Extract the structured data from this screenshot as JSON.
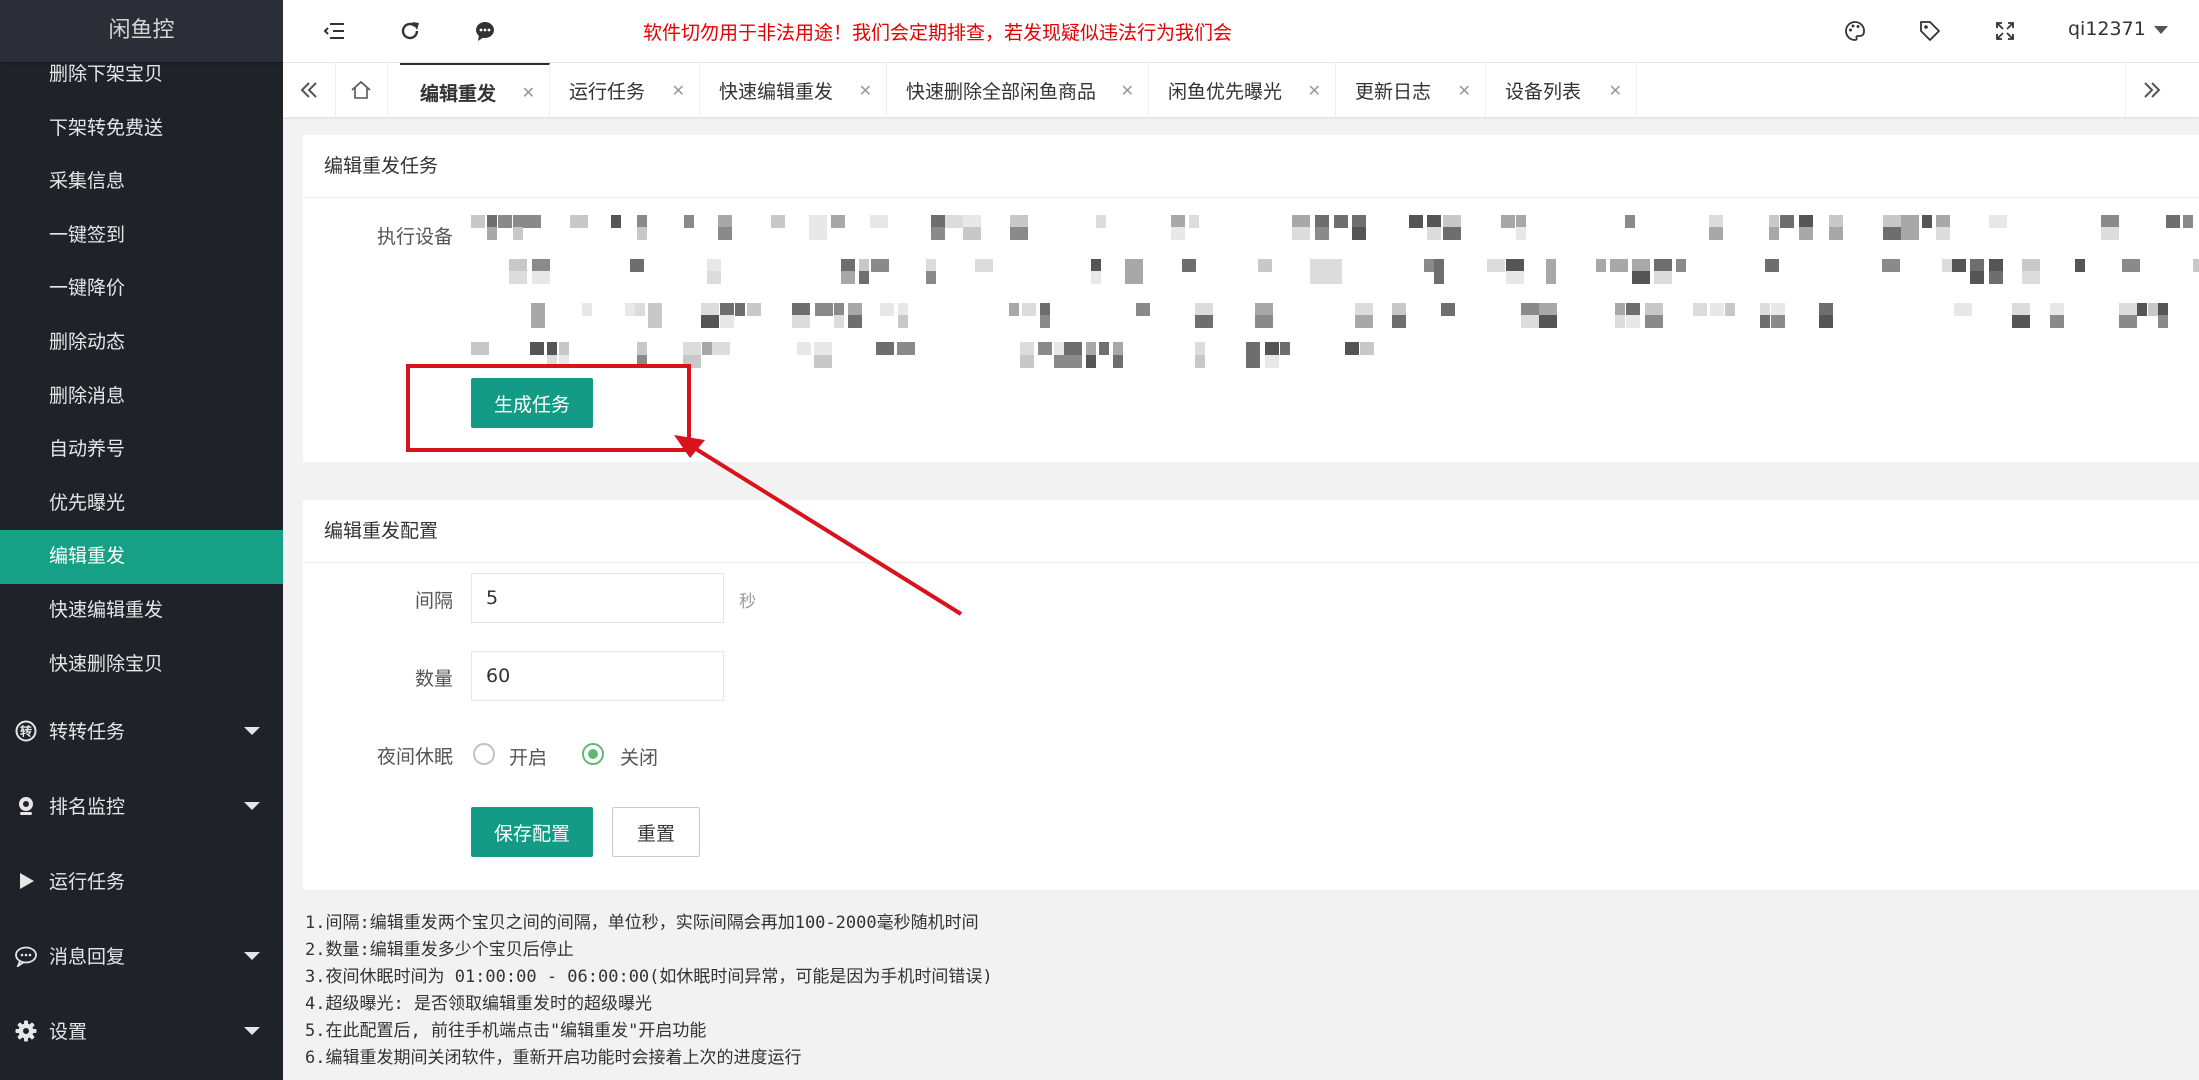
{
  "app": {
    "title": "闲鱼控"
  },
  "sidebar": {
    "sub_items": [
      {
        "label": "删除下架宝贝",
        "active": false
      },
      {
        "label": "下架转免费送",
        "active": false
      },
      {
        "label": "采集信息",
        "active": false
      },
      {
        "label": "一键签到",
        "active": false
      },
      {
        "label": "一键降价",
        "active": false
      },
      {
        "label": "删除动态",
        "active": false
      },
      {
        "label": "删除消息",
        "active": false
      },
      {
        "label": "自动养号",
        "active": false
      },
      {
        "label": "优先曝光",
        "active": false
      },
      {
        "label": "编辑重发",
        "active": true
      },
      {
        "label": "快速编辑重发",
        "active": false
      },
      {
        "label": "快速删除宝贝",
        "active": false
      }
    ],
    "groups": [
      {
        "label": "转转任务",
        "icon": "zhuanzhuan-icon",
        "has_caret": true
      },
      {
        "label": "排名监控",
        "icon": "webcam-icon",
        "has_caret": true
      },
      {
        "label": "运行任务",
        "icon": "play-icon",
        "has_caret": false
      },
      {
        "label": "消息回复",
        "icon": "chat-bubble-icon",
        "has_caret": true
      },
      {
        "label": "设置",
        "icon": "gear-icon",
        "has_caret": true
      }
    ]
  },
  "header": {
    "notice": "软件切勿用于非法用途！我们会定期排查，若发现疑似违法行为我们会",
    "user": "qi12371"
  },
  "tabs": [
    {
      "label": "编辑重发",
      "active": true
    },
    {
      "label": "运行任务",
      "active": false
    },
    {
      "label": "快速编辑重发",
      "active": false
    },
    {
      "label": "快速删除全部闲鱼商品",
      "active": false
    },
    {
      "label": "闲鱼优先曝光",
      "active": false
    },
    {
      "label": "更新日志",
      "active": false
    },
    {
      "label": "设备列表",
      "active": false
    }
  ],
  "task_card": {
    "title": "编辑重发任务",
    "device_label": "执行设备",
    "generate_button": "生成任务"
  },
  "config_card": {
    "title": "编辑重发配置",
    "interval_label": "间隔",
    "interval_value": "5",
    "interval_unit": "秒",
    "count_label": "数量",
    "count_value": "60",
    "night_label": "夜间休眠",
    "night_on": "开启",
    "night_off": "关闭",
    "night_selected": "关闭",
    "save_button": "保存配置",
    "reset_button": "重置"
  },
  "notes": [
    "1.间隔:编辑重发两个宝贝之间的间隔，单位秒，实际间隔会再加100-2000毫秒随机时间",
    "2.数量:编辑重发多少个宝贝后停止",
    "3.夜间休眠时间为 01:00:00 - 06:00:00(如休眠时间异常，可能是因为手机时间错误)",
    "4.超级曝光: 是否领取编辑重发时的超级曝光",
    "5.在此配置后, 前往手机端点击\"编辑重发\"开启功能",
    "6.编辑重发期间关闭软件，重新开启功能时会接着上次的进度运行"
  ],
  "colors": {
    "sidebar_bg": "#20222a",
    "accent_green": "#16a085",
    "notice_red": "#e60000",
    "annotation_red": "#d9131d"
  }
}
